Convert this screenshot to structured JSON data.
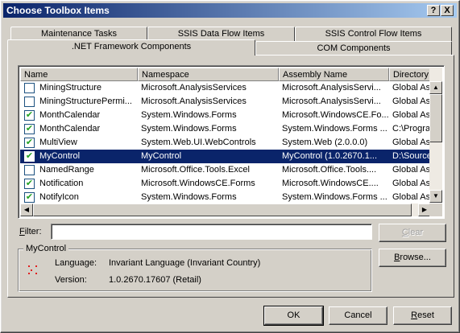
{
  "window": {
    "title": "Choose Toolbox Items",
    "help_label": "?",
    "close_label": "X"
  },
  "tabs_back": [
    {
      "label": "Maintenance Tasks"
    },
    {
      "label": "SSIS Data Flow Items"
    },
    {
      "label": "SSIS Control Flow Items"
    }
  ],
  "tabs_front": [
    {
      "label": ".NET Framework Components",
      "selected": true
    },
    {
      "label": "COM Components",
      "selected": false
    }
  ],
  "list": {
    "columns": [
      "Name",
      "Namespace",
      "Assembly Name",
      "Directory"
    ],
    "rows": [
      {
        "checked": false,
        "name": "MiningStructure",
        "namespace": "Microsoft.AnalysisServices",
        "assembly": "Microsoft.AnalysisServi...",
        "directory": "Global Ass"
      },
      {
        "checked": false,
        "name": "MiningStructurePermi...",
        "namespace": "Microsoft.AnalysisServices",
        "assembly": "Microsoft.AnalysisServi...",
        "directory": "Global Ass"
      },
      {
        "checked": true,
        "name": "MonthCalendar",
        "namespace": "System.Windows.Forms",
        "assembly": "Microsoft.WindowsCE.Fo...",
        "directory": "Global Ass"
      },
      {
        "checked": true,
        "name": "MonthCalendar",
        "namespace": "System.Windows.Forms",
        "assembly": "System.Windows.Forms ...",
        "directory": "C:\\Progra"
      },
      {
        "checked": true,
        "name": "MultiView",
        "namespace": "System.Web.UI.WebControls",
        "assembly": "System.Web (2.0.0.0)",
        "directory": "Global Ass"
      },
      {
        "checked": true,
        "name": "MyControl",
        "namespace": "MyControl",
        "assembly": "MyControl (1.0.2670.1...",
        "directory": "D:\\Source",
        "selected": true
      },
      {
        "checked": false,
        "name": "NamedRange",
        "namespace": "Microsoft.Office.Tools.Excel",
        "assembly": "Microsoft.Office.Tools....",
        "directory": "Global Ass"
      },
      {
        "checked": true,
        "name": "Notification",
        "namespace": "Microsoft.WindowsCE.Forms",
        "assembly": "Microsoft.WindowsCE....",
        "directory": "Global Ass"
      },
      {
        "checked": true,
        "name": "NotifyIcon",
        "namespace": "System.Windows.Forms",
        "assembly": "System.Windows.Forms ...",
        "directory": "Global Ass"
      }
    ]
  },
  "filter": {
    "label_pre": "",
    "label_accel": "F",
    "label_post": "ilter:",
    "value": ""
  },
  "buttons": {
    "clear": {
      "accel": "C",
      "rest": "lear"
    },
    "browse": {
      "accel": "B",
      "rest": "rowse..."
    },
    "ok": "OK",
    "cancel": "Cancel",
    "reset": {
      "accel": "R",
      "rest": "eset"
    }
  },
  "details": {
    "group_title": "MyControl",
    "language_label": "Language:",
    "language_value": "Invariant Language (Invariant Country)",
    "version_label": "Version:",
    "version_value": "1.0.2670.17607 (Retail)"
  },
  "colors": {
    "selection": "#0a246a",
    "face": "#d4d0c8",
    "check": "#21a121"
  }
}
